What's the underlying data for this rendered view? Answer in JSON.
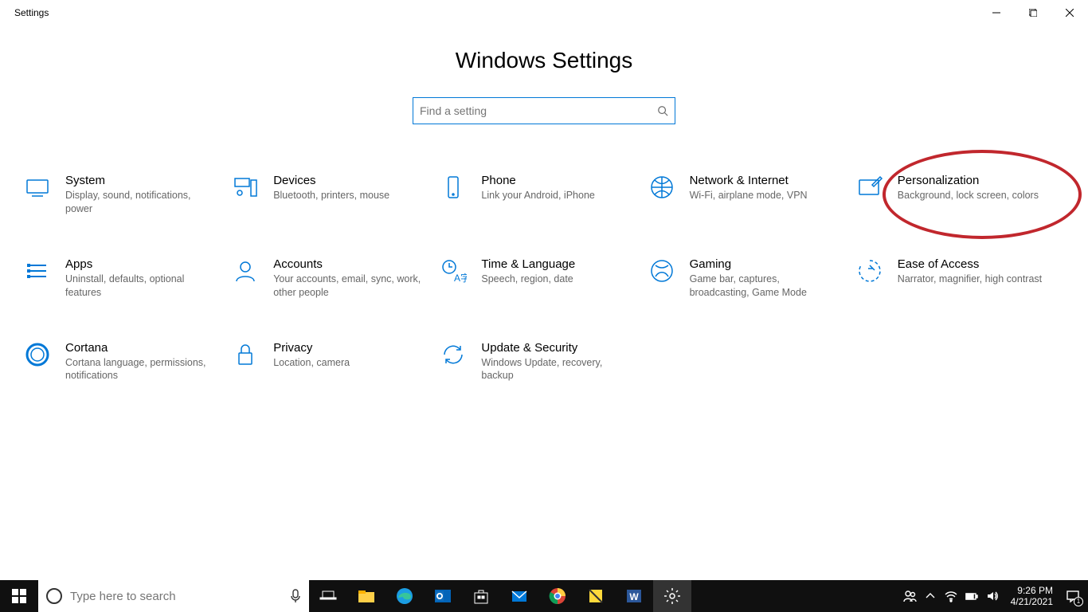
{
  "window": {
    "title": "Settings"
  },
  "page": {
    "heading": "Windows Settings"
  },
  "search": {
    "placeholder": "Find a setting"
  },
  "categories": [
    {
      "id": "system",
      "title": "System",
      "desc": "Display, sound, notifications, power"
    },
    {
      "id": "devices",
      "title": "Devices",
      "desc": "Bluetooth, printers, mouse"
    },
    {
      "id": "phone",
      "title": "Phone",
      "desc": "Link your Android, iPhone"
    },
    {
      "id": "network",
      "title": "Network & Internet",
      "desc": "Wi-Fi, airplane mode, VPN"
    },
    {
      "id": "personalization",
      "title": "Personalization",
      "desc": "Background, lock screen, colors"
    },
    {
      "id": "apps",
      "title": "Apps",
      "desc": "Uninstall, defaults, optional features"
    },
    {
      "id": "accounts",
      "title": "Accounts",
      "desc": "Your accounts, email, sync, work, other people"
    },
    {
      "id": "time",
      "title": "Time & Language",
      "desc": "Speech, region, date"
    },
    {
      "id": "gaming",
      "title": "Gaming",
      "desc": "Game bar, captures, broadcasting, Game Mode"
    },
    {
      "id": "ease",
      "title": "Ease of Access",
      "desc": "Narrator, magnifier, high contrast"
    },
    {
      "id": "cortana",
      "title": "Cortana",
      "desc": "Cortana language, permissions, notifications"
    },
    {
      "id": "privacy",
      "title": "Privacy",
      "desc": "Location, camera"
    },
    {
      "id": "update",
      "title": "Update & Security",
      "desc": "Windows Update, recovery, backup"
    }
  ],
  "taskbar": {
    "search_placeholder": "Type here to search",
    "time": "9:26 PM",
    "date": "4/21/2021",
    "notification_count": "1"
  },
  "annotation": {
    "target": "personalization"
  }
}
